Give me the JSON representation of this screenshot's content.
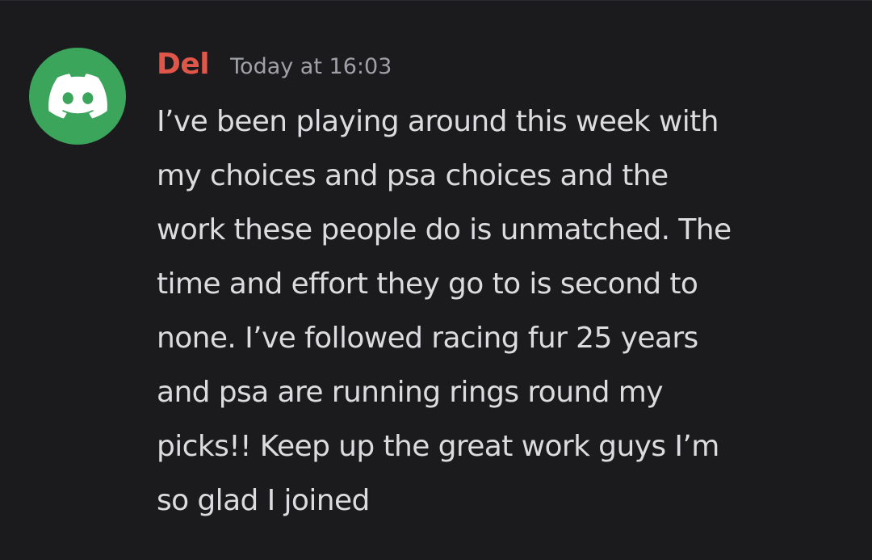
{
  "message": {
    "avatar_icon": "discord-logo-icon",
    "avatar_color": "#3ba55c",
    "author": "Del",
    "author_color": "#e0574a",
    "timestamp": "Today at 16:03",
    "lines": [
      "I’ve been playing around this week with",
      "my choices and psa choices and the",
      "work these people do is unmatched. The",
      "time and effort they go to is second to",
      "none. I’ve followed racing fur 25 years",
      "and psa are running rings round my",
      "picks!! Keep up the great work guys I’m",
      "so glad I joined"
    ]
  }
}
